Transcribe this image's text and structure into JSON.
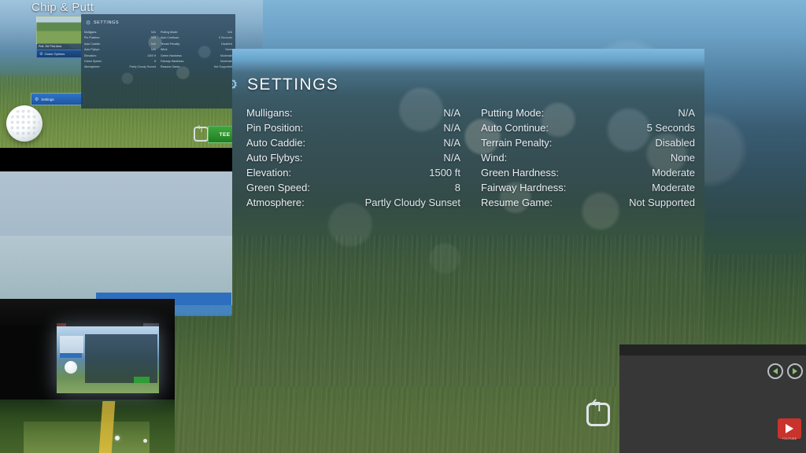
{
  "game_window": {
    "title": "Chip & Putt",
    "thumbnail_caption": "Putt: 3W Flat Area",
    "menu_item": {
      "label": "Game Options",
      "icon": "sliders-icon"
    },
    "settings_item": {
      "label": "Settings",
      "icon": "gear-icon"
    },
    "tee_off_button": "TEE OFF!",
    "reset_icon": "reset-arrow-icon"
  },
  "settings_panel": {
    "title": "SETTINGS",
    "icon": "gear-icon",
    "left_column": [
      {
        "label": "Mulligans:",
        "value": "N/A"
      },
      {
        "label": "Pin Position:",
        "value": "N/A"
      },
      {
        "label": "Auto Caddie:",
        "value": "N/A"
      },
      {
        "label": "Auto Flybys:",
        "value": "N/A"
      },
      {
        "label": "Elevation:",
        "value": "1500 ft"
      },
      {
        "label": "Green Speed:",
        "value": "8"
      },
      {
        "label": "Atmosphere:",
        "value": "Partly Cloudy Sunset"
      }
    ],
    "right_column": [
      {
        "label": "Putting Mode:",
        "value": "N/A"
      },
      {
        "label": "Auto Continue:",
        "value": "5 Seconds"
      },
      {
        "label": "Terrain Penalty:",
        "value": "Disabled"
      },
      {
        "label": "Wind:",
        "value": "None"
      },
      {
        "label": "Green Hardness:",
        "value": "Moderate"
      },
      {
        "label": "Fairway Hardness:",
        "value": "Moderate"
      },
      {
        "label": "Resume Game:",
        "value": "Not Supported"
      }
    ],
    "reset_icon": "reset-arrow-icon"
  },
  "controls": {
    "prev_label": "◀",
    "next_label": "▶",
    "play_badge_caption": "YOUTUBE",
    "play_icon": "play-icon"
  },
  "colors": {
    "accent_blue": "#2d6fbe",
    "tee_off_green": "#2f9c35",
    "badge_red": "#c9332b",
    "panel_dark": "#373737"
  }
}
